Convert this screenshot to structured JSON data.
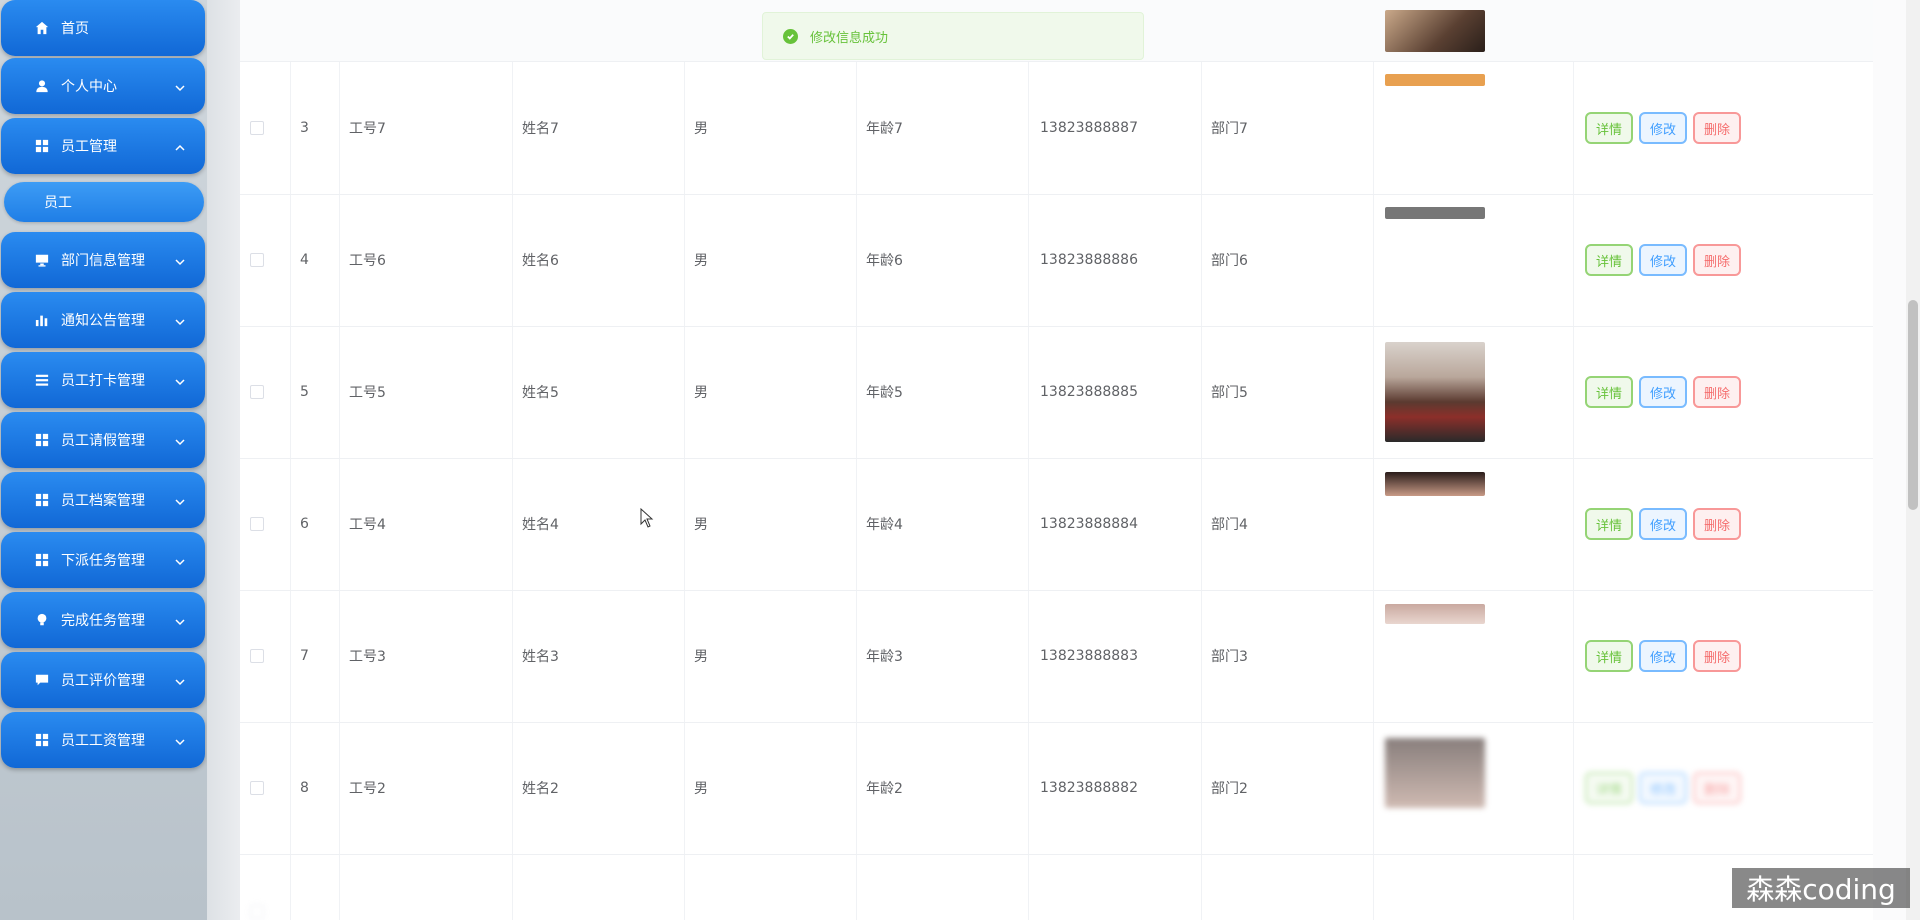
{
  "sidebar": {
    "items": [
      {
        "label": "首页",
        "icon": "home-icon",
        "top": 0
      },
      {
        "label": "个人中心",
        "icon": "user-icon"
      },
      {
        "label": "员工管理",
        "icon": "grid-icon"
      },
      {
        "label": "部门信息管理",
        "icon": "monitor-icon"
      },
      {
        "label": "通知公告管理",
        "icon": "bar-chart-icon"
      },
      {
        "label": "员工打卡管理",
        "icon": "list-icon"
      },
      {
        "label": "员工请假管理",
        "icon": "grid-icon"
      },
      {
        "label": "员工档案管理",
        "icon": "grid-icon"
      },
      {
        "label": "下派任务管理",
        "icon": "grid-icon"
      },
      {
        "label": "完成任务管理",
        "icon": "bulb-icon"
      },
      {
        "label": "员工评价管理",
        "icon": "chat-icon"
      },
      {
        "label": "员工工资管理",
        "icon": "grid-icon"
      }
    ],
    "submenu_label": "员工"
  },
  "toast": {
    "message": "修改信息成功"
  },
  "buttons": {
    "detail": "详情",
    "edit": "修改",
    "delete": "删除"
  },
  "rows": [
    {
      "index": "3",
      "emp_no": "工号7",
      "name": "姓名7",
      "gender": "男",
      "age": "年龄7",
      "phone": "13823888887",
      "dept": "部门7"
    },
    {
      "index": "4",
      "emp_no": "工号6",
      "name": "姓名6",
      "gender": "男",
      "age": "年龄6",
      "phone": "13823888886",
      "dept": "部门6"
    },
    {
      "index": "5",
      "emp_no": "工号5",
      "name": "姓名5",
      "gender": "男",
      "age": "年龄5",
      "phone": "13823888885",
      "dept": "部门5"
    },
    {
      "index": "6",
      "emp_no": "工号4",
      "name": "姓名4",
      "gender": "男",
      "age": "年龄4",
      "phone": "13823888884",
      "dept": "部门4"
    },
    {
      "index": "7",
      "emp_no": "工号3",
      "name": "姓名3",
      "gender": "男",
      "age": "年龄3",
      "phone": "13823888883",
      "dept": "部门3"
    },
    {
      "index": "8",
      "emp_no": "工号2",
      "name": "姓名2",
      "gender": "男",
      "age": "年龄2",
      "phone": "13823888882",
      "dept": "部门2"
    }
  ],
  "watermark": "森森coding"
}
